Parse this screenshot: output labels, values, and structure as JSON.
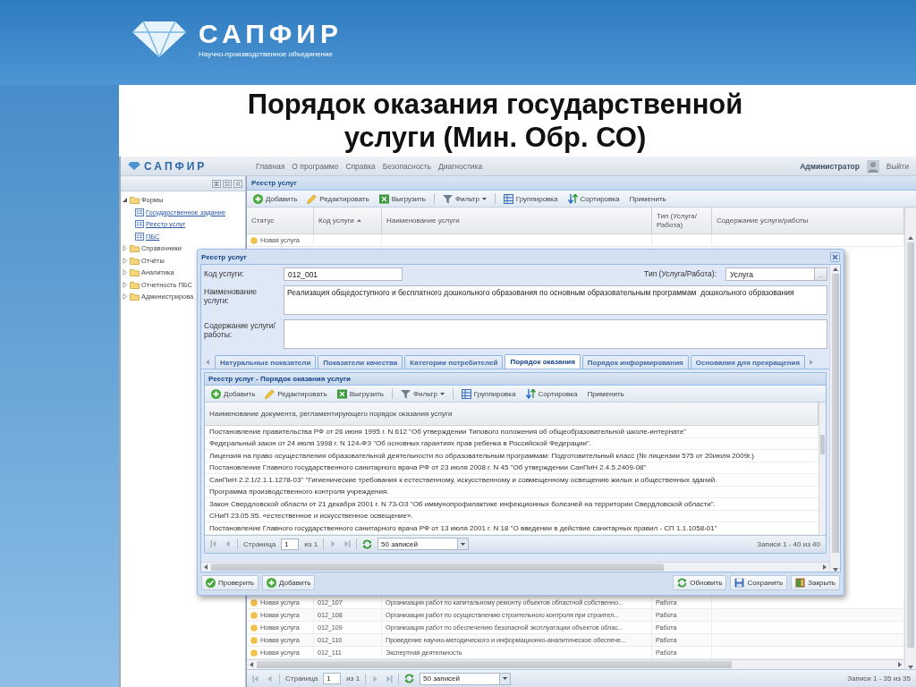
{
  "slide": {
    "brand": "САПФИР",
    "tagline": "Научно-производственное объединение",
    "title": "Порядок оказания государственной услуги (Мин. Обр. СО)"
  },
  "app": {
    "brand": "САПФИР",
    "nav": [
      "Главная",
      "О программе",
      "Справка",
      "Безопасность",
      "Диагностика"
    ],
    "user": "Администратор",
    "logout": "Выйти"
  },
  "sidebar": {
    "items": [
      {
        "label": "Формы",
        "expanded": true,
        "children": [
          {
            "label": "Государственное задание"
          },
          {
            "label": "Реестр услуг"
          },
          {
            "label": "ПБС"
          }
        ]
      },
      {
        "label": "Справочники",
        "expanded": false
      },
      {
        "label": "Отчёты",
        "expanded": false
      },
      {
        "label": "Аналитика",
        "expanded": false
      },
      {
        "label": "Отчетность ПБС",
        "expanded": false
      },
      {
        "label": "Администрирова",
        "expanded": false
      }
    ]
  },
  "registry": {
    "title": "Реестр услуг",
    "toolbar": [
      {
        "label": "Добавить",
        "kind": "add"
      },
      {
        "label": "Редактировать",
        "kind": "edit"
      },
      {
        "label": "Выгрузить",
        "kind": "export"
      },
      {
        "label": "Фильтр",
        "kind": "filter"
      },
      {
        "label": "Группировка",
        "kind": "group"
      },
      {
        "label": "Сортировка",
        "kind": "sort"
      },
      {
        "label": "Применить",
        "kind": "apply"
      }
    ],
    "columns": [
      {
        "label": "Статус"
      },
      {
        "label": "Код услуги",
        "sorted": true
      },
      {
        "label": "Наименование услуги"
      },
      {
        "label": "Тип (Услуга/Работа)"
      },
      {
        "label": "Содержание услуги/работы"
      }
    ],
    "rows": [
      {
        "status": "Новая услуга"
      }
    ],
    "more_rows": [
      {
        "status": "Новая услуга",
        "code": "012_107",
        "name": "Организация работ по капитальному ремонту объектов областной собственно...",
        "type": "Работа"
      },
      {
        "status": "Новая услуга",
        "code": "012_108",
        "name": "Организация работ по осуществлению строительного контроля при строител...",
        "type": "Работа"
      },
      {
        "status": "Новая услуга",
        "code": "012_109",
        "name": "Организация работ по обеспечению безопасной эксплуатации объектов облас...",
        "type": "Работа"
      },
      {
        "status": "Новая услуга",
        "code": "012_110",
        "name": "Проведение научно-методического и информационно-аналитическое обеспече...",
        "type": "Работа"
      },
      {
        "status": "Новая услуга",
        "code": "012_111",
        "name": "Экспертная деятельность",
        "type": "Работа"
      }
    ],
    "pager": {
      "page_label": "Страница",
      "page": "1",
      "of": "из 1",
      "page_size": "50 записей",
      "summary": "Записи 1 - 35 из 35"
    }
  },
  "dialog": {
    "title": "Реестр услуг",
    "code_label": "Код услуги:",
    "code": "012_001",
    "type_label": "Тип (Услуга/Работа):",
    "type": "Услуга",
    "type_button": "...",
    "name_label": "Наименование услуги:",
    "name": "Реализация общедоступного и бесплатного дошкольного образования по основным образовательным программам  дошкольного образования",
    "content_label": "Содержание услуги/ работы:",
    "tabs": [
      {
        "label": "Натуральные показатели",
        "selected": false
      },
      {
        "label": "Показатели качества",
        "selected": false
      },
      {
        "label": "Категории потребителей",
        "selected": false
      },
      {
        "label": "Порядок оказания",
        "selected": true
      },
      {
        "label": "Порядок информирования",
        "selected": false
      },
      {
        "label": "Основания для прекращения",
        "selected": false
      }
    ],
    "panel": {
      "title": "Реестр услуг - Порядок оказания услуги",
      "toolbar": [
        {
          "label": "Добавить",
          "kind": "add"
        },
        {
          "label": "Редактировать",
          "kind": "edit"
        },
        {
          "label": "Выгрузить",
          "kind": "export"
        },
        {
          "label": "Фильтр",
          "kind": "filter"
        },
        {
          "label": "Группировка",
          "kind": "group"
        },
        {
          "label": "Сортировка",
          "kind": "sort"
        },
        {
          "label": "Применить",
          "kind": "apply"
        }
      ],
      "column": "Наименование документа, регламентирующего порядок оказания услуги",
      "rows": [
        "Постановление правительства РФ от 26 июня 1995 г. N 612 \"Об утверждении Типового положения об общеобразовательной школе-интернате\"",
        "Федеральный закон от 24 июля 1998 г. N 124-ФЗ \"Об основных гарантиях прав ребенка в Российской Федерации\".",
        "Лицензия на право осуществления образовательной деятельности по образовательным программам: Подготовительный класс (№ лицензии 575 от 20июля 2009г.)",
        "Постановление Главного государственного санитарного врача РФ от 23 июля 2008 г. N 45 \"Об утверждении СанПиН 2.4.5.2409-08\"",
        "СанПиН 2.2.1/2.1.1.1278-03\" \"Гигиенические требования к естественному, искусственному и совмещенному освещению жилых и общественных зданий.",
        "Программа производственного контроля учреждения.",
        "Закон Свердловской области от 21 декабря 2001 г. N 73-ОЗ \"Об иммунопрофилактике инфекционных болезней на территории Свердловской области\".",
        "СНиП 23.05.95. «естественное и искусственное освещение».",
        "Постановление Главного государственного санитарного врача РФ от 13 июля 2001 г. N 18 \"О введении в действие санитарных правил - СП 1.1.1058-01\""
      ],
      "pager": {
        "page_label": "Страница",
        "page": "1",
        "of": "из 1",
        "page_size": "50 записей",
        "summary": "Записи 1 - 40 из 40"
      }
    },
    "buttons_left": [
      {
        "label": "Проверить",
        "kind": "check"
      },
      {
        "label": "Добавить",
        "kind": "add"
      }
    ],
    "buttons_right": [
      {
        "label": "Обновить",
        "kind": "refresh"
      },
      {
        "label": "Сохранить",
        "kind": "save"
      },
      {
        "label": "Закрыть",
        "kind": "close"
      }
    ]
  }
}
